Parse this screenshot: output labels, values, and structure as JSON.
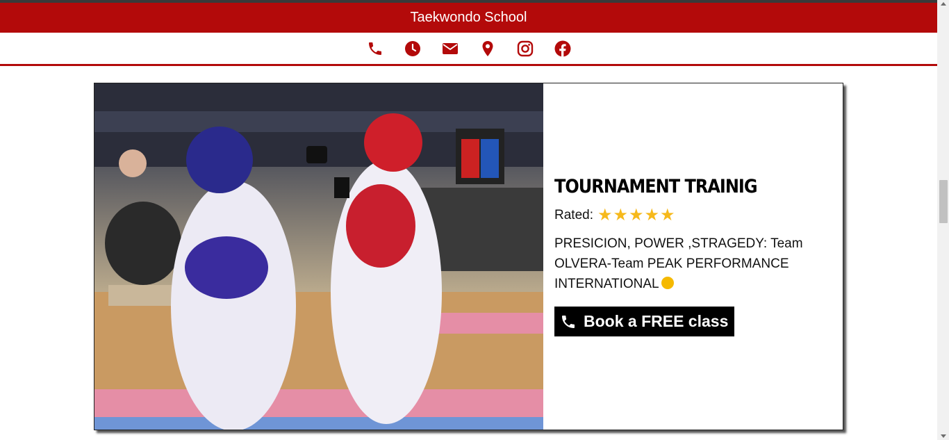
{
  "header": {
    "title": "Taekwondo School"
  },
  "contact_icons": [
    "phone-icon",
    "clock-icon",
    "envelope-icon",
    "map-pin-icon",
    "instagram-icon",
    "facebook-icon"
  ],
  "colors": {
    "brand_red": "#b30a0a",
    "star_gold": "#f6b91c",
    "button_bg": "#000000"
  },
  "card": {
    "title": "TOURNAMENT TRAINIG",
    "rating_label": "Rated:",
    "rating_stars": 5,
    "description": "PRESICION, POWER ,STRAGEDY: Team OLVERA-Team PEAK PERFORMANCE INTERNATIONAL",
    "button_label": "Book a FREE class"
  }
}
